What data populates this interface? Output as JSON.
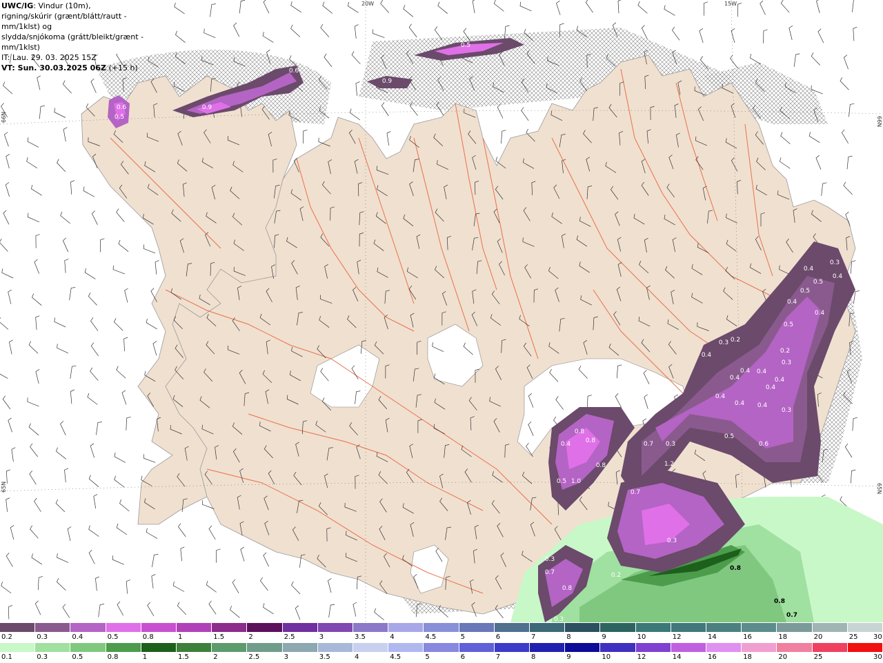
{
  "header": {
    "model": "UWC/IG",
    "title_rest": ": Vindur (10m),",
    "line2": "rigning/skúrir (grænt/blátt/rautt - mm/1klst) og",
    "line3": "slydda/snjókoma (grátt/bleikt/grænt - mm/1klst)",
    "issue": "IT: Lau. 29. 03. 2025 15Z",
    "valid": "VT: Sun. 30.03.2025 06Z",
    "lead": "(+15 h)"
  },
  "gridlabels": {
    "lon_top_left": "20W",
    "lon_top_right": "15W",
    "lat_left_upper": "66N",
    "lat_right_upper": "66N",
    "lat_left_lower": "65N",
    "lat_right_lower": "65N"
  },
  "colors": {
    "land": "#f0e0d0",
    "sea": "#ffffff",
    "roads": "#e8643c",
    "snow_purple": "#c25bd6",
    "rain_green": "#5fb85f"
  },
  "snow_labels": [
    "0.6",
    "0.5",
    "0.6",
    "0.9",
    "0.5",
    "0.9",
    "0.3",
    "0.4",
    "0.5",
    "0.4",
    "0.5",
    "0.4",
    "0.4",
    "0.5",
    "0.2",
    "0.3",
    "0.2",
    "0.4",
    "0.3",
    "0.4",
    "0.4",
    "0.4",
    "0.4",
    "0.4",
    "0.4",
    "0.4",
    "0.4",
    "0.3",
    "0.5",
    "0.6",
    "0.8",
    "0.4",
    "0.8",
    "0.8",
    "0.5",
    "1.0",
    "0.7",
    "0.3",
    "1.2",
    "0.7",
    "0.3",
    "0.3",
    "0.7",
    "0.8",
    "0.2",
    "0.3"
  ],
  "rain_labels": [
    "0.8",
    "0.8",
    "0.7"
  ],
  "legend": {
    "snow_colors": [
      "#6b4a6b",
      "#8a5a8e",
      "#b464c4",
      "#e070e8",
      "#c850d0",
      "#b040b8",
      "#8c2c8c",
      "#5c105c",
      "#7030a0",
      "#8048b0",
      "#8c78c8",
      "#a8a8e8",
      "#8890d8",
      "#6878b8",
      "#507090",
      "#3c6878",
      "#2c5060",
      "#2e6460",
      "#3c7878",
      "#40787c",
      "#4c8080",
      "#5c8c8c",
      "#7c9a9a",
      "#a0b4b4",
      "#c8d4d4"
    ],
    "snow_labels": [
      "0.2",
      "0.3",
      "0.4",
      "0.5",
      "0.8",
      "1",
      "1.5",
      "2",
      "2.5",
      "3",
      "3.5",
      "4",
      "4.5",
      "5",
      "6",
      "7",
      "8",
      "9",
      "10",
      "12",
      "14",
      "16",
      "18",
      "20",
      "25",
      "30"
    ],
    "rain_colors": [
      "#c8f8c8",
      "#a0e0a0",
      "#80c880",
      "#4c9c4c",
      "#1c601c",
      "#3c803c",
      "#5c9c6c",
      "#709c8c",
      "#8ca8b0",
      "#a8b8d8",
      "#c8d0f0",
      "#b0b8f0",
      "#8888e0",
      "#6060d8",
      "#3c3cc8",
      "#2020b0",
      "#0c0c98",
      "#4030c0",
      "#8040d0",
      "#c060e0",
      "#e090f0",
      "#f0a0d0",
      "#f080a0",
      "#f04060",
      "#f01010"
    ],
    "rain_labels": [
      "0.1",
      "0.3",
      "0.5",
      "0.8",
      "1",
      "1.5",
      "2",
      "2.5",
      "3",
      "3.5",
      "4",
      "4.5",
      "5",
      "6",
      "7",
      "8",
      "9",
      "10",
      "12",
      "14",
      "16",
      "18",
      "20",
      "25",
      "30"
    ]
  }
}
